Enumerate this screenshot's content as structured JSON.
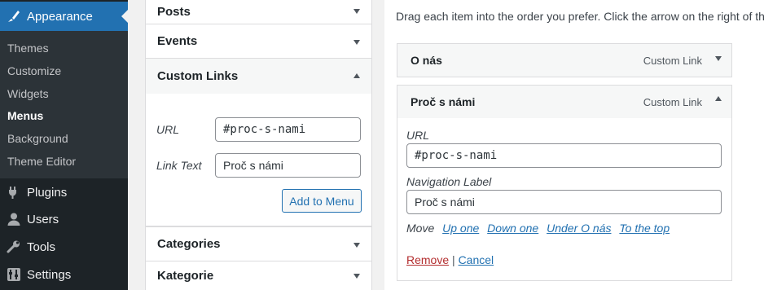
{
  "sidebar": {
    "active": {
      "label": "Appearance",
      "icon": "paintbrush-icon"
    },
    "submenu": [
      "Themes",
      "Customize",
      "Widgets",
      "Menus",
      "Background",
      "Theme Editor"
    ],
    "current_submenu": "Menus",
    "items": [
      {
        "label": "Plugins",
        "icon": "plug-icon"
      },
      {
        "label": "Users",
        "icon": "user-icon"
      },
      {
        "label": "Tools",
        "icon": "wrench-icon"
      },
      {
        "label": "Settings",
        "icon": "settings-icon"
      }
    ]
  },
  "add_items": {
    "panels": [
      "Posts",
      "Events",
      "Custom Links",
      "Categories",
      "Kategorie"
    ],
    "custom_links": {
      "url_label": "URL",
      "url_value": "#proc-s-nami",
      "link_text_label": "Link Text",
      "link_text_value": "Proč s námi",
      "add_button": "Add to Menu"
    }
  },
  "menu_structure": {
    "instructions": "Drag each item into the order you prefer. Click the arrow on the right of the",
    "items": [
      {
        "title": "O nás",
        "type": "Custom Link"
      },
      {
        "title": "Proč s námi",
        "type": "Custom Link"
      }
    ],
    "edit": {
      "url_label": "URL",
      "url_value": "#proc-s-nami",
      "nav_label": "Navigation Label",
      "nav_value": "Proč s námi",
      "move_label": "Move",
      "move_links": [
        "Up one",
        "Down one",
        "Under O nás",
        "To the top"
      ],
      "remove": "Remove",
      "separator": "|",
      "cancel": "Cancel"
    }
  },
  "colors": {
    "sidebar_bg": "#1d2327",
    "sidebar_active": "#2271b1",
    "link": "#2271b1",
    "remove": "#b32d2e"
  }
}
